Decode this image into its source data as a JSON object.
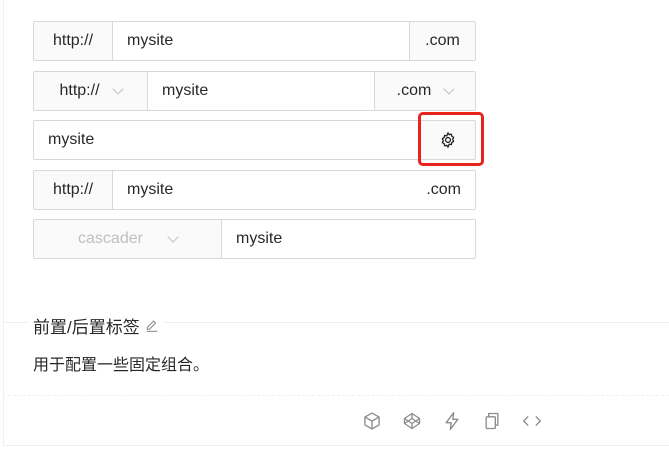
{
  "rows": [
    {
      "prefix": "http://",
      "value": "mysite",
      "suffix": ".com"
    },
    {
      "prefix_select": "http://",
      "value": "mysite",
      "suffix_select": ".com"
    },
    {
      "value": "mysite"
    },
    {
      "prefix": "http://",
      "value": "mysite",
      "suffix": ".com"
    },
    {
      "cascader_placeholder": "cascader",
      "value": "mysite"
    }
  ],
  "section": {
    "title": "前置/后置标签",
    "description": "用于配置一些固定组合。"
  },
  "icons": {
    "gear": "gear-icon",
    "edit": "edit-icon",
    "codesandbox": "codesandbox-icon",
    "codepen": "codepen-icon",
    "stackblitz": "stackblitz-icon",
    "copy": "copy-icon",
    "code": "code-icon"
  },
  "colors": {
    "highlight": "#e8231b",
    "border": "#d9d9d9",
    "addon_bg": "#fafafa"
  }
}
